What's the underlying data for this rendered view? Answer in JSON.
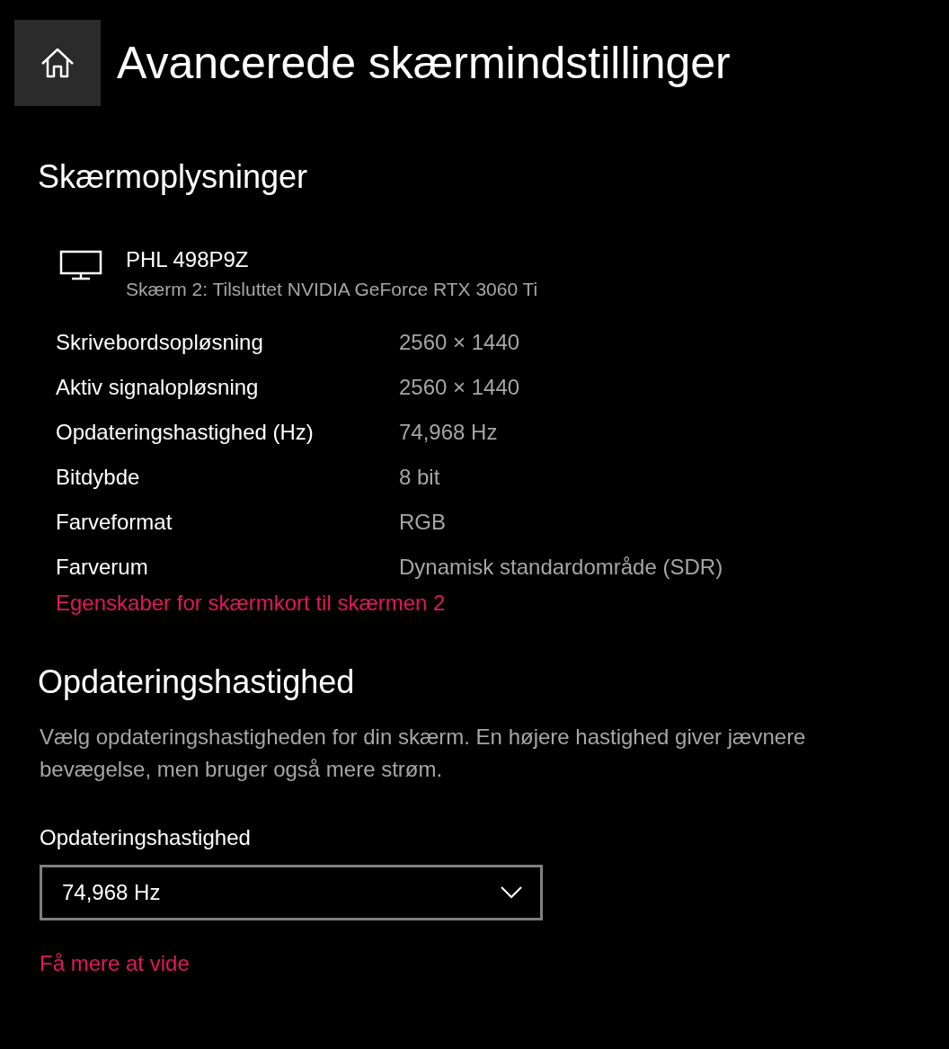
{
  "page": {
    "title": "Avancerede skærmindstillinger"
  },
  "display_info": {
    "heading": "Skærmoplysninger",
    "monitor_name": "PHL 498P9Z",
    "monitor_subtitle": "Skærm 2: Tilsluttet NVIDIA GeForce RTX 3060 Ti",
    "rows": [
      {
        "label": "Skrivebordsopløsning",
        "value": "2560 × 1440"
      },
      {
        "label": "Aktiv signalopløsning",
        "value": "2560 × 1440"
      },
      {
        "label": "Opdateringshastighed (Hz)",
        "value": "74,968 Hz"
      },
      {
        "label": "Bitdybde",
        "value": "8 bit"
      },
      {
        "label": "Farveformat",
        "value": "RGB"
      },
      {
        "label": "Farverum",
        "value": "Dynamisk standardområde (SDR)"
      }
    ],
    "link": "Egenskaber for skærmkort til skærmen 2"
  },
  "refresh_rate": {
    "heading": "Opdateringshastighed",
    "description": "Vælg opdateringshastigheden for din skærm. En højere hastighed giver jævnere bevægelse, men bruger også mere strøm.",
    "dropdown_label": "Opdateringshastighed",
    "dropdown_value": "74,968 Hz",
    "link": "Få mere at vide"
  }
}
